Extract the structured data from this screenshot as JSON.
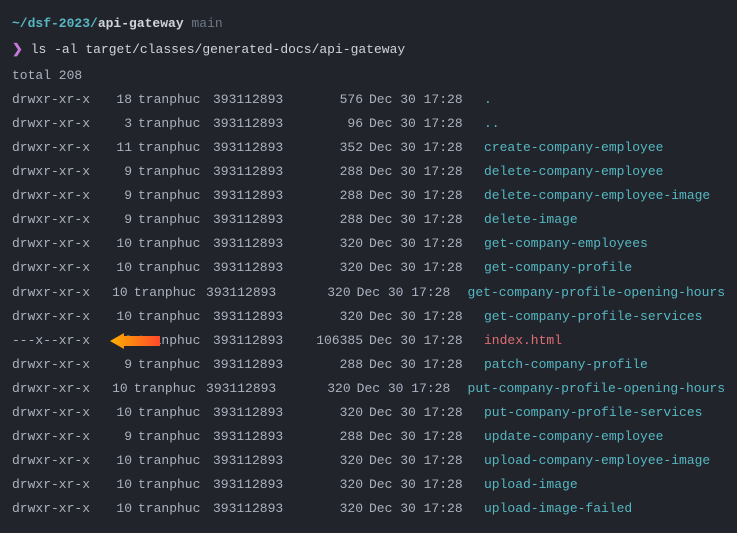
{
  "prompt": {
    "path_prefix": "~/dsf-2023/",
    "dir": "api-gateway",
    "branch": "main",
    "symbol": "❯",
    "command": "ls -al target/classes/generated-docs/api-gateway"
  },
  "total_line": "total 208",
  "entries": [
    {
      "perm": "drwxr-xr-x",
      "links": "18",
      "owner": "tranphuc",
      "group": "393112893",
      "size": "576",
      "date": "Dec 30 17:28",
      "name": ".",
      "style": "cyan",
      "arrow": false
    },
    {
      "perm": "drwxr-xr-x",
      "links": "3",
      "owner": "tranphuc",
      "group": "393112893",
      "size": "96",
      "date": "Dec 30 17:28",
      "name": "..",
      "style": "cyan",
      "arrow": false
    },
    {
      "perm": "drwxr-xr-x",
      "links": "11",
      "owner": "tranphuc",
      "group": "393112893",
      "size": "352",
      "date": "Dec 30 17:28",
      "name": "create-company-employee",
      "style": "cyan",
      "arrow": false
    },
    {
      "perm": "drwxr-xr-x",
      "links": "9",
      "owner": "tranphuc",
      "group": "393112893",
      "size": "288",
      "date": "Dec 30 17:28",
      "name": "delete-company-employee",
      "style": "cyan",
      "arrow": false
    },
    {
      "perm": "drwxr-xr-x",
      "links": "9",
      "owner": "tranphuc",
      "group": "393112893",
      "size": "288",
      "date": "Dec 30 17:28",
      "name": "delete-company-employee-image",
      "style": "cyan",
      "arrow": false
    },
    {
      "perm": "drwxr-xr-x",
      "links": "9",
      "owner": "tranphuc",
      "group": "393112893",
      "size": "288",
      "date": "Dec 30 17:28",
      "name": "delete-image",
      "style": "cyan",
      "arrow": false
    },
    {
      "perm": "drwxr-xr-x",
      "links": "10",
      "owner": "tranphuc",
      "group": "393112893",
      "size": "320",
      "date": "Dec 30 17:28",
      "name": "get-company-employees",
      "style": "cyan",
      "arrow": false
    },
    {
      "perm": "drwxr-xr-x",
      "links": "10",
      "owner": "tranphuc",
      "group": "393112893",
      "size": "320",
      "date": "Dec 30 17:28",
      "name": "get-company-profile",
      "style": "cyan",
      "arrow": false
    },
    {
      "perm": "drwxr-xr-x",
      "links": "10",
      "owner": "tranphuc",
      "group": "393112893",
      "size": "320",
      "date": "Dec 30 17:28",
      "name": "get-company-profile-opening-hours",
      "style": "cyan",
      "arrow": false
    },
    {
      "perm": "drwxr-xr-x",
      "links": "10",
      "owner": "tranphuc",
      "group": "393112893",
      "size": "320",
      "date": "Dec 30 17:28",
      "name": "get-company-profile-services",
      "style": "cyan",
      "arrow": false
    },
    {
      "perm": "---x--xr-x",
      "links": "10",
      "owner": "tranphuc",
      "group": "393112893",
      "size": "106385",
      "date": "Dec 30 17:28",
      "name": "index.html",
      "style": "salmon",
      "arrow": true
    },
    {
      "perm": "drwxr-xr-x",
      "links": "9",
      "owner": "tranphuc",
      "group": "393112893",
      "size": "288",
      "date": "Dec 30 17:28",
      "name": "patch-company-profile",
      "style": "cyan",
      "arrow": false
    },
    {
      "perm": "drwxr-xr-x",
      "links": "10",
      "owner": "tranphuc",
      "group": "393112893",
      "size": "320",
      "date": "Dec 30 17:28",
      "name": "put-company-profile-opening-hours",
      "style": "cyan",
      "arrow": false
    },
    {
      "perm": "drwxr-xr-x",
      "links": "10",
      "owner": "tranphuc",
      "group": "393112893",
      "size": "320",
      "date": "Dec 30 17:28",
      "name": "put-company-profile-services",
      "style": "cyan",
      "arrow": false
    },
    {
      "perm": "drwxr-xr-x",
      "links": "9",
      "owner": "tranphuc",
      "group": "393112893",
      "size": "288",
      "date": "Dec 30 17:28",
      "name": "update-company-employee",
      "style": "cyan",
      "arrow": false
    },
    {
      "perm": "drwxr-xr-x",
      "links": "10",
      "owner": "tranphuc",
      "group": "393112893",
      "size": "320",
      "date": "Dec 30 17:28",
      "name": "upload-company-employee-image",
      "style": "cyan",
      "arrow": false
    },
    {
      "perm": "drwxr-xr-x",
      "links": "10",
      "owner": "tranphuc",
      "group": "393112893",
      "size": "320",
      "date": "Dec 30 17:28",
      "name": "upload-image",
      "style": "cyan",
      "arrow": false
    },
    {
      "perm": "drwxr-xr-x",
      "links": "10",
      "owner": "tranphuc",
      "group": "393112893",
      "size": "320",
      "date": "Dec 30 17:28",
      "name": "upload-image-failed",
      "style": "cyan",
      "arrow": false
    }
  ]
}
